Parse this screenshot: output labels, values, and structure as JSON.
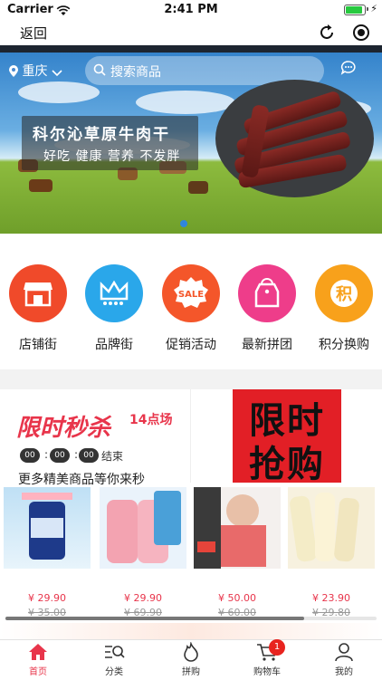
{
  "status_bar": {
    "carrier": "Carrier",
    "time": "2:41 PM"
  },
  "nav": {
    "back_label": "返回"
  },
  "banner": {
    "location": "重庆",
    "search_placeholder": "搜索商品",
    "promo_title": "科尔沁草原牛肉干",
    "promo_subtitle": "好吃 健康 营养 不发胖"
  },
  "categories": [
    {
      "label": "店铺街",
      "color": "#f04a2a",
      "icon": "store-icon"
    },
    {
      "label": "品牌街",
      "color": "#2aa7ea",
      "icon": "crown-icon"
    },
    {
      "label": "促销活动",
      "color": "#f4562a",
      "icon": "sale-icon"
    },
    {
      "label": "最新拼团",
      "color": "#ee3d8a",
      "icon": "tag-icon"
    },
    {
      "label": "积分换购",
      "color": "#f8a11b",
      "icon": "points-icon",
      "icon_text": "积"
    }
  ],
  "flash_sale": {
    "title": "限时秒杀",
    "session": "14点场",
    "countdown": [
      "00",
      "00",
      "00"
    ],
    "countdown_suffix": "结束",
    "more_text": "更多精美商品等你来秒",
    "banner_line1": "限时",
    "banner_line2": "抢购",
    "products": [
      {
        "price": "¥ 29.90",
        "old_price": "¥ 35.00"
      },
      {
        "price": "¥ 29.90",
        "old_price": "¥ 69.90"
      },
      {
        "price": "¥ 50.00",
        "old_price": "¥ 60.00"
      },
      {
        "price": "¥ 23.90",
        "old_price": "¥ 29.80"
      }
    ]
  },
  "tabs": [
    {
      "label": "首页",
      "icon": "home-icon",
      "active": true
    },
    {
      "label": "分类",
      "icon": "category-icon"
    },
    {
      "label": "拼购",
      "icon": "fire-icon"
    },
    {
      "label": "购物车",
      "icon": "cart-icon",
      "badge": "1"
    },
    {
      "label": "我的",
      "icon": "profile-icon"
    }
  ],
  "colors": {
    "accent": "#e8354b",
    "badge": "#e8231f"
  }
}
